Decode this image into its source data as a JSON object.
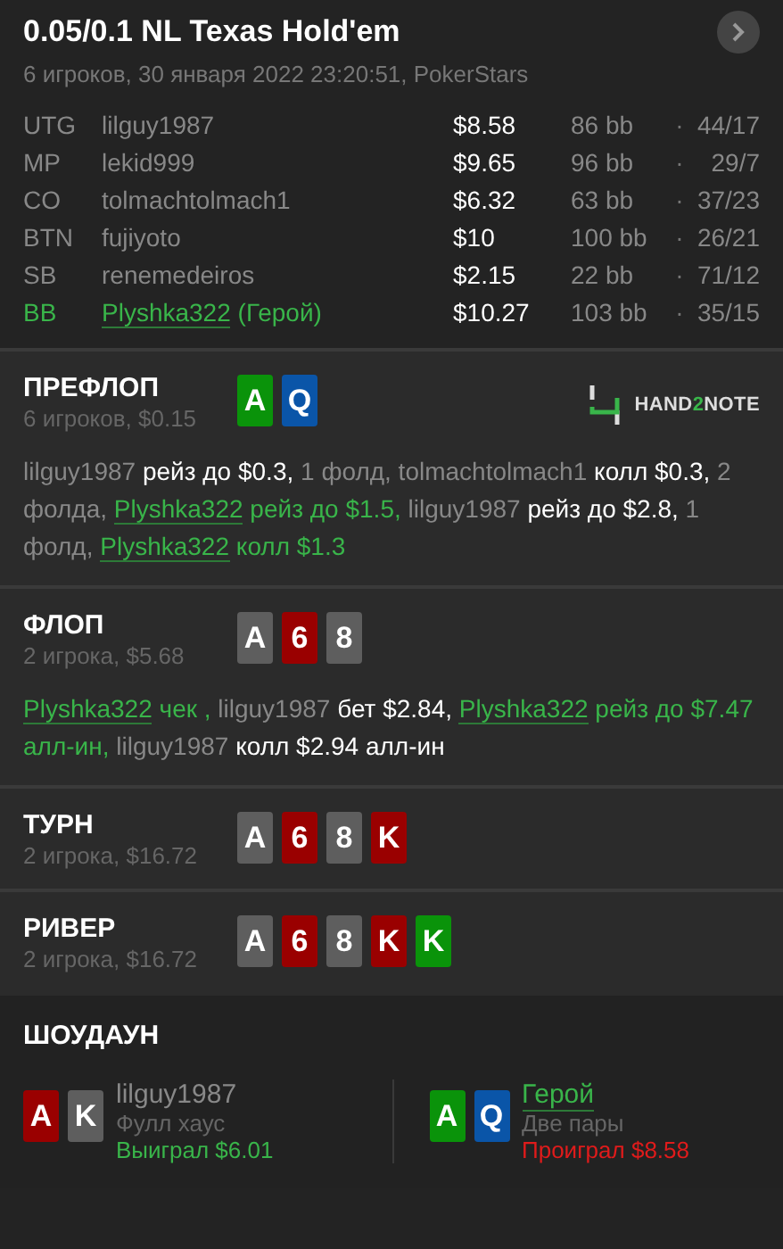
{
  "header": {
    "title": "0.05/0.1 NL Texas Hold'em",
    "subtitle": "6 игроков, 30 января 2022 23:20:51, PokerStars"
  },
  "players": [
    {
      "position": "UTG",
      "name": "lilguy1987",
      "hero": false,
      "stack": "$8.58",
      "bb": "86 bb",
      "separator": "·",
      "stats": "44/17"
    },
    {
      "position": "MP",
      "name": "lekid999",
      "hero": false,
      "stack": "$9.65",
      "bb": "96 bb",
      "separator": "·",
      "stats": "29/7"
    },
    {
      "position": "CO",
      "name": "tolmachtolmach1",
      "hero": false,
      "stack": "$6.32",
      "bb": "63 bb",
      "separator": "·",
      "stats": "37/23"
    },
    {
      "position": "BTN",
      "name": "fujiyoto",
      "hero": false,
      "stack": "$10",
      "bb": "100 bb",
      "separator": "·",
      "stats": "26/21"
    },
    {
      "position": "SB",
      "name": "renemedeiros",
      "hero": false,
      "stack": "$2.15",
      "bb": "22 bb",
      "separator": "·",
      "stats": "71/12"
    },
    {
      "position": "BB",
      "name": "Plyshka322",
      "hero": true,
      "hero_label": "(Герой)",
      "stack": "$10.27",
      "bb": "103 bb",
      "separator": "·",
      "stats": "35/15"
    }
  ],
  "streets": [
    {
      "title": "ПРЕФЛОП",
      "info": "6 игроков, $0.15",
      "cards": [
        {
          "rank": "A",
          "color": "#0a930a"
        },
        {
          "rank": "Q",
          "color": "#0a55a8"
        }
      ],
      "logo": [
        {
          "text": "HAND",
          "accent": false
        },
        {
          "text": "2",
          "accent": true
        },
        {
          "text": "NOTE",
          "accent": false
        }
      ],
      "actions": [
        {
          "kind": "name",
          "text": "lilguy1987 "
        },
        {
          "kind": "act",
          "text": "рейз до $0.3, "
        },
        {
          "kind": "muted",
          "text": "1 фолд, tolmachtolmach1 "
        },
        {
          "kind": "act",
          "text": "колл $0.3, "
        },
        {
          "kind": "muted",
          "text": "2 фолда, "
        },
        {
          "kind": "hero",
          "text": "Plyshka322"
        },
        {
          "kind": "hero_act",
          "text": " рейз до $1.5, "
        },
        {
          "kind": "name",
          "text": "lilguy1987 "
        },
        {
          "kind": "act",
          "text": "рейз до $2.8, "
        },
        {
          "kind": "muted",
          "text": "1 фолд, "
        },
        {
          "kind": "hero",
          "text": "Plyshka322"
        },
        {
          "kind": "hero_act",
          "text": " колл $1.3"
        }
      ]
    },
    {
      "title": "ФЛОП",
      "info": "2 игрока, $5.68",
      "cards": [
        {
          "rank": "A",
          "color": "#5e5e5e"
        },
        {
          "rank": "6",
          "color": "#9a0000"
        },
        {
          "rank": "8",
          "color": "#5e5e5e"
        }
      ],
      "actions": [
        {
          "kind": "hero",
          "text": "Plyshka322"
        },
        {
          "kind": "hero_act",
          "text": " чек , "
        },
        {
          "kind": "name",
          "text": "lilguy1987 "
        },
        {
          "kind": "act",
          "text": "бет $2.84, "
        },
        {
          "kind": "hero",
          "text": "Plyshka322"
        },
        {
          "kind": "hero_act",
          "text": " рейз до $7.47 алл-ин, "
        },
        {
          "kind": "name",
          "text": "lilguy1987 "
        },
        {
          "kind": "act",
          "text": "колл $2.94 алл-ин"
        }
      ]
    },
    {
      "title": "ТУРН",
      "info": "2 игрока, $16.72",
      "cards": [
        {
          "rank": "A",
          "color": "#5e5e5e"
        },
        {
          "rank": "6",
          "color": "#9a0000"
        },
        {
          "rank": "8",
          "color": "#5e5e5e"
        },
        {
          "rank": "K",
          "color": "#9a0000"
        }
      ]
    },
    {
      "title": "РИВЕР",
      "info": "2 игрока, $16.72",
      "cards": [
        {
          "rank": "A",
          "color": "#5e5e5e"
        },
        {
          "rank": "6",
          "color": "#9a0000"
        },
        {
          "rank": "8",
          "color": "#5e5e5e"
        },
        {
          "rank": "K",
          "color": "#9a0000"
        },
        {
          "rank": "K",
          "color": "#0a930a"
        }
      ]
    }
  ],
  "showdown": {
    "title": "ШОУДАУН",
    "hands": [
      {
        "cards": [
          {
            "rank": "A",
            "color": "#9a0000"
          },
          {
            "rank": "K",
            "color": "#5e5e5e"
          }
        ],
        "name": "lilguy1987",
        "hero": false,
        "hand": "Фулл хаус",
        "result": "Выиграл $6.01",
        "won": true
      },
      {
        "cards": [
          {
            "rank": "A",
            "color": "#0a930a"
          },
          {
            "rank": "Q",
            "color": "#0a55a8"
          }
        ],
        "name": "Герой",
        "hero": true,
        "hand": "Две пары",
        "result": "Проиграл $8.58",
        "won": false
      }
    ]
  }
}
